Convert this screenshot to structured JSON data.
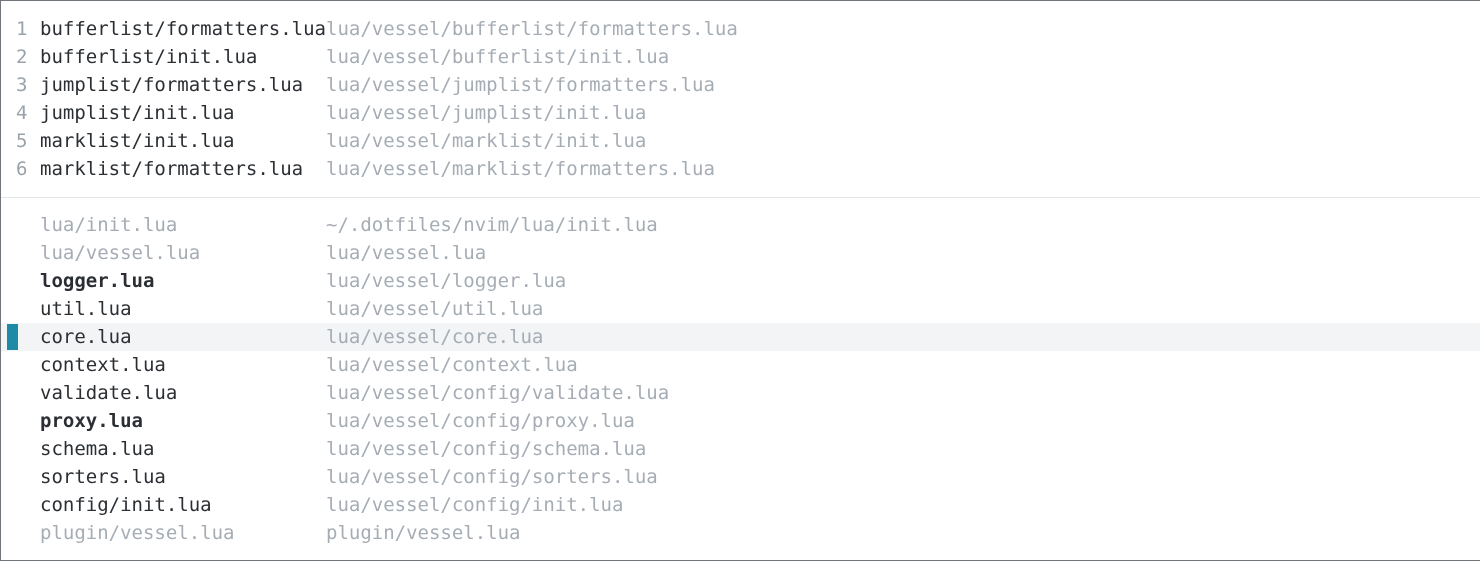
{
  "pinned": [
    {
      "num": "1",
      "name": "bufferlist/formatters.lua",
      "path": "lua/vessel/bufferlist/formatters.lua"
    },
    {
      "num": "2",
      "name": "bufferlist/init.lua",
      "path": "lua/vessel/bufferlist/init.lua"
    },
    {
      "num": "3",
      "name": "jumplist/formatters.lua",
      "path": "lua/vessel/jumplist/formatters.lua"
    },
    {
      "num": "4",
      "name": "jumplist/init.lua",
      "path": "lua/vessel/jumplist/init.lua"
    },
    {
      "num": "5",
      "name": "marklist/init.lua",
      "path": "lua/vessel/marklist/init.lua"
    },
    {
      "num": "6",
      "name": "marklist/formatters.lua",
      "path": "lua/vessel/marklist/formatters.lua"
    }
  ],
  "buffers": [
    {
      "name": "lua/init.lua",
      "path": "~/.dotfiles/nvim/lua/init.lua",
      "style": "dim"
    },
    {
      "name": "lua/vessel.lua",
      "path": "lua/vessel.lua",
      "style": "dim"
    },
    {
      "name": "logger.lua",
      "path": "lua/vessel/logger.lua",
      "style": "bold"
    },
    {
      "name": "util.lua",
      "path": "lua/vessel/util.lua",
      "style": "normal"
    },
    {
      "name": "core.lua",
      "path": "lua/vessel/core.lua",
      "style": "normal",
      "selected": true
    },
    {
      "name": "context.lua",
      "path": "lua/vessel/context.lua",
      "style": "normal"
    },
    {
      "name": "validate.lua",
      "path": "lua/vessel/config/validate.lua",
      "style": "normal"
    },
    {
      "name": "proxy.lua",
      "path": "lua/vessel/config/proxy.lua",
      "style": "bold"
    },
    {
      "name": "schema.lua",
      "path": "lua/vessel/config/schema.lua",
      "style": "normal"
    },
    {
      "name": "sorters.lua",
      "path": "lua/vessel/config/sorters.lua",
      "style": "normal"
    },
    {
      "name": "config/init.lua",
      "path": "lua/vessel/config/init.lua",
      "style": "normal"
    },
    {
      "name": "plugin/vessel.lua",
      "path": "plugin/vessel.lua",
      "style": "dim"
    }
  ],
  "colors": {
    "selection_marker": "#1f8aa6",
    "selection_background": "#f3f4f6",
    "dim_text": "#a5acb3",
    "normal_text": "#2b2f33"
  }
}
